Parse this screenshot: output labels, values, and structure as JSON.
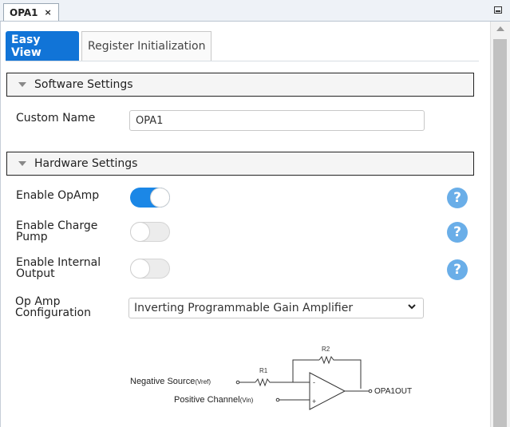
{
  "document_tab": {
    "title": "OPA1",
    "close": "×"
  },
  "subtabs": {
    "easy_view": "Easy View",
    "register_init": "Register Initialization"
  },
  "software_settings": {
    "header": "Software Settings",
    "custom_name_label": "Custom Name",
    "custom_name_value": "OPA1"
  },
  "hardware_settings": {
    "header": "Hardware Settings",
    "enable_opamp": {
      "label": "Enable OpAmp",
      "state": true
    },
    "enable_charge_pump": {
      "label_line1": "Enable Charge",
      "label_line2": "Pump",
      "state": false
    },
    "enable_internal_output": {
      "label_line1": "Enable Internal",
      "label_line2": "Output",
      "state": false
    },
    "op_amp_config": {
      "label_line1": "Op Amp",
      "label_line2": "Configuration",
      "value": "Inverting Programmable Gain Amplifier"
    },
    "help_icon_text": "?"
  },
  "diagram": {
    "r2": "R2",
    "r1": "R1",
    "negative_source": "Negative Source",
    "negative_source_sub": "(Vref)",
    "positive_channel": "Positive Channel",
    "positive_channel_sub": "(Vin)",
    "output": "OPA1OUT",
    "minus": "-",
    "plus": "+"
  },
  "colors": {
    "accent": "#1174d7",
    "toggle_on": "#1b87e6",
    "help": "#6aaee8"
  }
}
